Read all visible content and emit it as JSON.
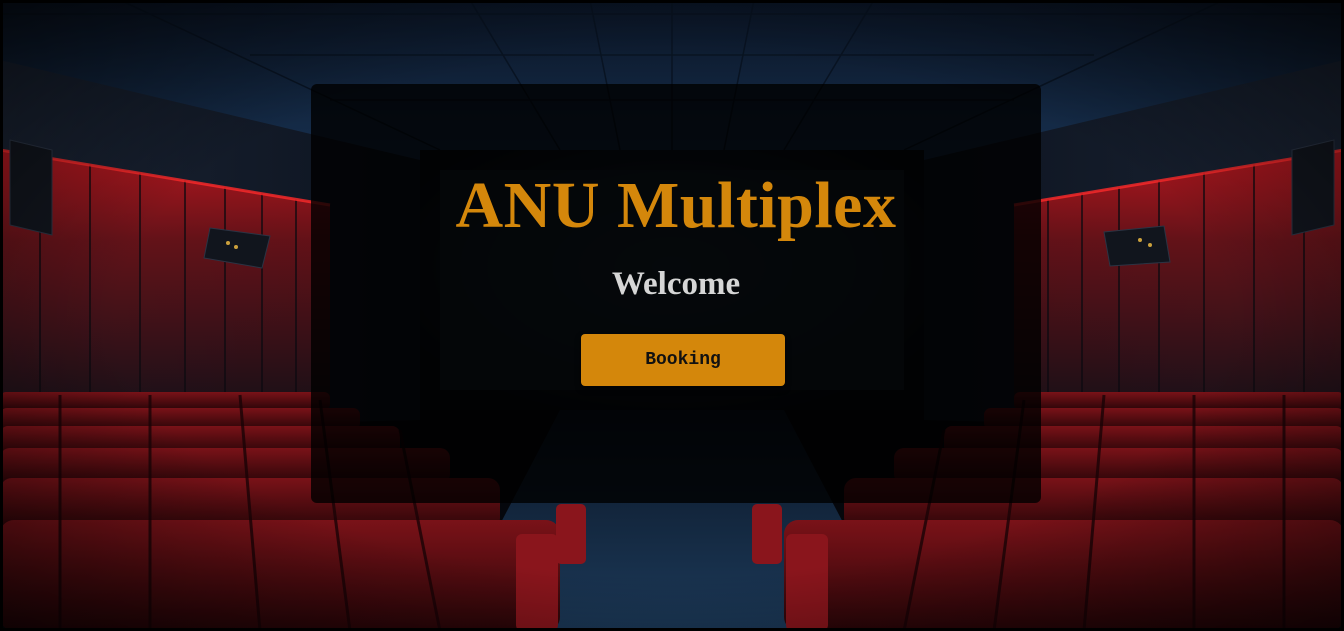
{
  "hero": {
    "title": "ANU Multiplex",
    "subtitle": "Welcome",
    "booking_label": "Booking"
  },
  "colors": {
    "accent": "#d4870b",
    "subtitle_text": "#d6d6d6",
    "overlay": "rgba(0,0,0,0.80)",
    "seat_red": "#5e0c10",
    "wall_light_red": "#c0141a",
    "ceiling_blue": "#0e1e33"
  },
  "background": {
    "scene": "dark cinema auditorium with red seats"
  }
}
